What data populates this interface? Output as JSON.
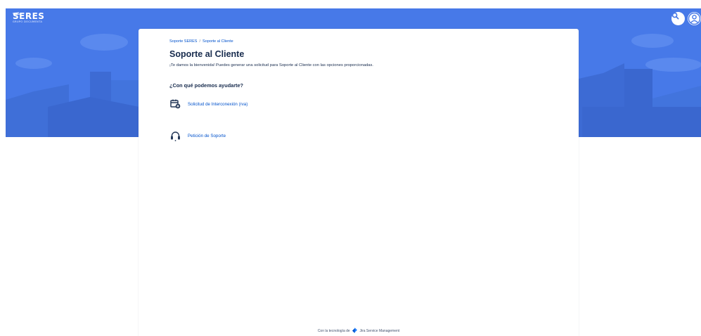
{
  "header": {
    "logo_text": "SERES",
    "logo_subtext": "GRUPO DOCUMENTA",
    "search_icon": "search-icon",
    "avatar_icon": "user-avatar-icon"
  },
  "breadcrumb": {
    "items": [
      "Soporte SERES",
      "Soporte al Cliente"
    ],
    "separator": "/"
  },
  "page": {
    "title": "Soporte al Cliente",
    "welcome": "¡Te damos la bienvenida! Puedes generar una solicitud para Soporte al Cliente con las opciones proporcionadas.",
    "help_heading": "¿Con qué podemos ayudarte?"
  },
  "options": [
    {
      "label": "Solicitud de Interconexión (rva)",
      "icon": "calendar-plus-icon"
    },
    {
      "label": "Petición de Soporte",
      "icon": "headset-icon"
    }
  ],
  "footer": {
    "prefix": "Con la tecnología de",
    "product": "Jira Service Management"
  },
  "colors": {
    "banner": "#4779e8",
    "link": "#0052cc",
    "text": "#172b4d"
  }
}
